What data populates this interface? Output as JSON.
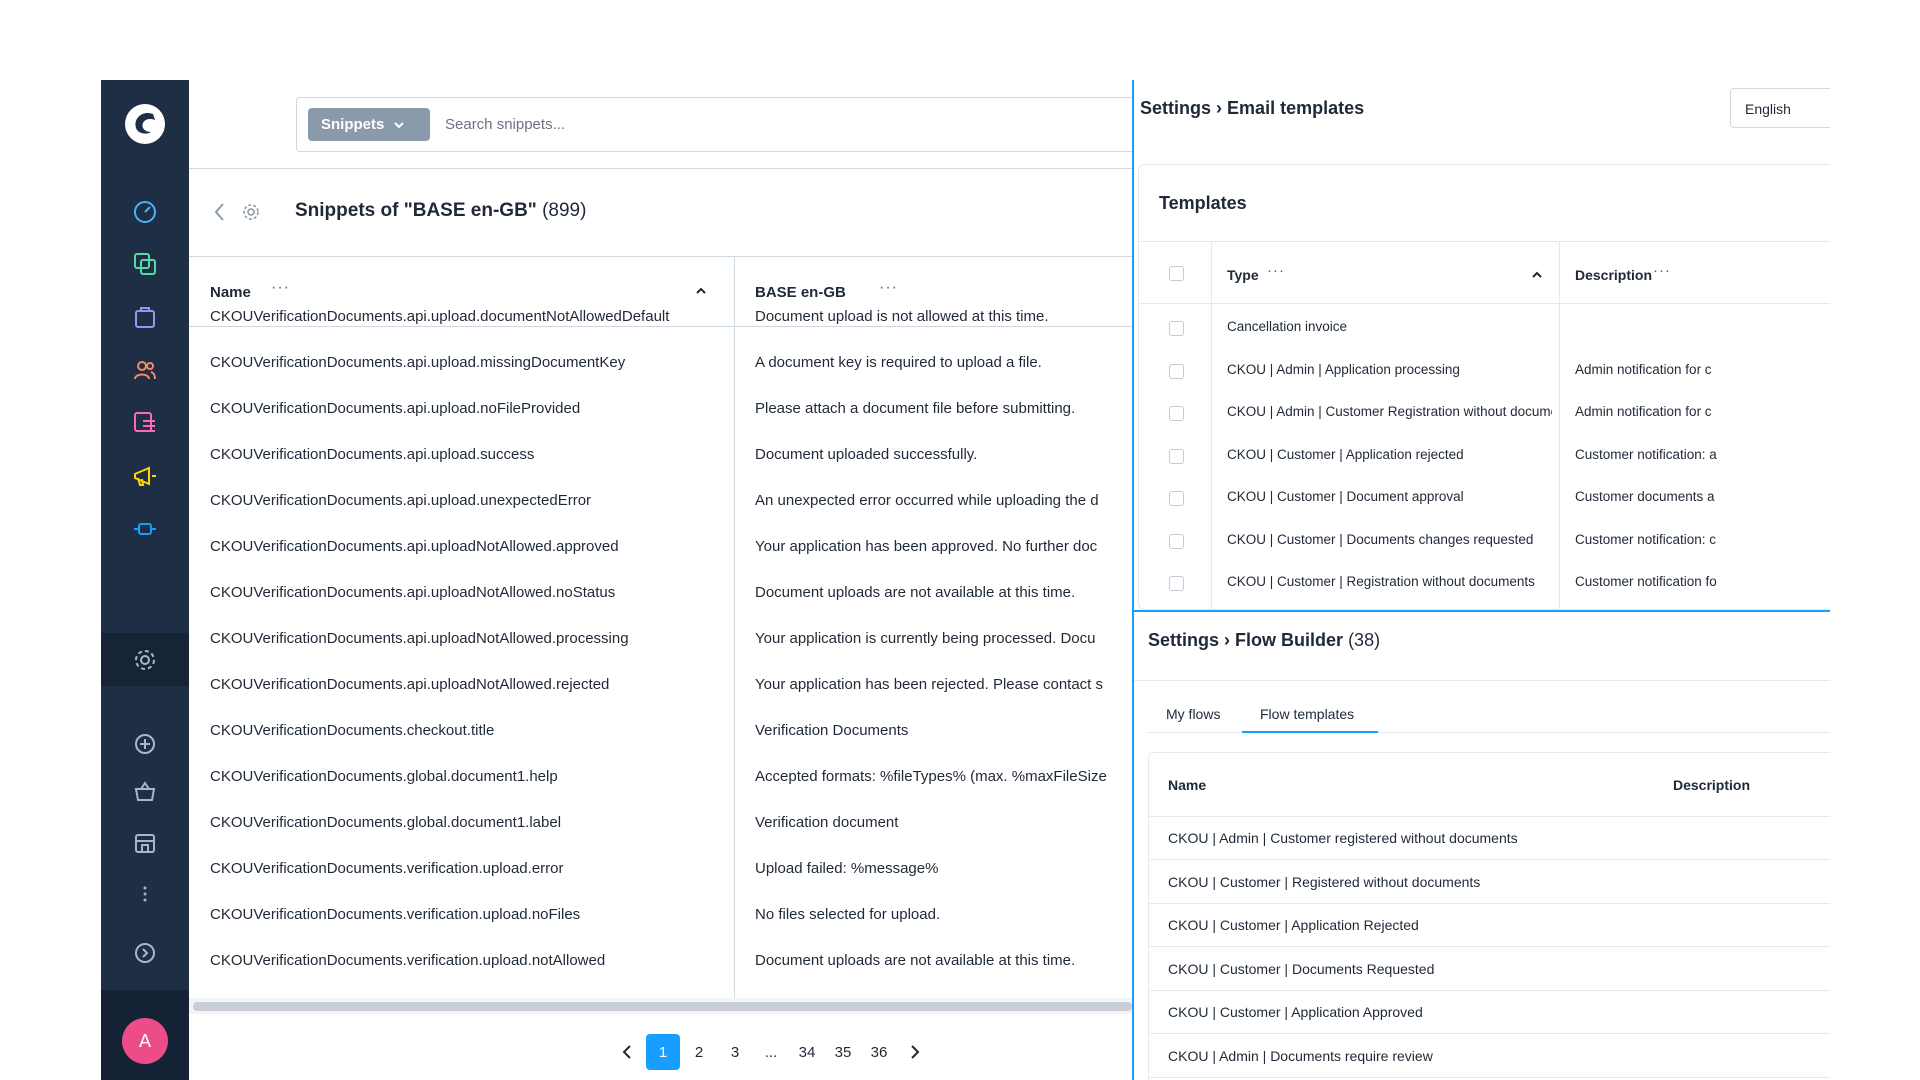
{
  "search": {
    "button_label": "Snippets",
    "placeholder": "Search snippets..."
  },
  "header": {
    "title": "Snippets of \"BASE en-GB\"",
    "count": "(899)"
  },
  "grid": {
    "columns": [
      "Name",
      "BASE en-GB"
    ],
    "dots": "···",
    "rows": [
      {
        "name": "CKOUVerificationDocuments.api.upload.documentNotAllowedDefault",
        "value": "Document upload is not allowed at this time."
      },
      {
        "name": "CKOUVerificationDocuments.api.upload.missingDocumentKey",
        "value": "A document key is required to upload a file."
      },
      {
        "name": "CKOUVerificationDocuments.api.upload.noFileProvided",
        "value": "Please attach a document file before submitting."
      },
      {
        "name": "CKOUVerificationDocuments.api.upload.success",
        "value": "Document uploaded successfully."
      },
      {
        "name": "CKOUVerificationDocuments.api.upload.unexpectedError",
        "value": "An unexpected error occurred while uploading the d"
      },
      {
        "name": "CKOUVerificationDocuments.api.uploadNotAllowed.approved",
        "value": "Your application has been approved. No further doc"
      },
      {
        "name": "CKOUVerificationDocuments.api.uploadNotAllowed.noStatus",
        "value": "Document uploads are not available at this time."
      },
      {
        "name": "CKOUVerificationDocuments.api.uploadNotAllowed.processing",
        "value": "Your application is currently being processed. Docu"
      },
      {
        "name": "CKOUVerificationDocuments.api.uploadNotAllowed.rejected",
        "value": "Your application has been rejected. Please contact s"
      },
      {
        "name": "CKOUVerificationDocuments.checkout.title",
        "value": "Verification Documents"
      },
      {
        "name": "CKOUVerificationDocuments.global.document1.help",
        "value": "Accepted formats: %fileTypes% (max. %maxFileSize"
      },
      {
        "name": "CKOUVerificationDocuments.global.document1.label",
        "value": "Verification document"
      },
      {
        "name": "CKOUVerificationDocuments.verification.upload.error",
        "value": "Upload failed: %message%"
      },
      {
        "name": "CKOUVerificationDocuments.verification.upload.noFiles",
        "value": "No files selected for upload."
      },
      {
        "name": "CKOUVerificationDocuments.verification.upload.notAllowed",
        "value": "Document uploads are not available at this time."
      }
    ]
  },
  "pagination": {
    "pages": [
      "1",
      "2",
      "3",
      "...",
      "34",
      "35",
      "36"
    ],
    "active": "1"
  },
  "user": {
    "avatar_letter": "A"
  },
  "email_templates": {
    "breadcrumb_parent": "Settings",
    "breadcrumb_current": "Email templates",
    "language": "English",
    "card_title": "Templates",
    "columns": [
      "Type",
      "Description"
    ],
    "rows": [
      {
        "type": "Cancellation invoice",
        "description": ""
      },
      {
        "type": "CKOU | Admin | Application processing",
        "description": "Admin notification for c"
      },
      {
        "type": "CKOU | Admin | Customer Registration without documents",
        "description": "Admin notification for c"
      },
      {
        "type": "CKOU | Customer | Application rejected",
        "description": "Customer notification: a"
      },
      {
        "type": "CKOU | Customer | Document approval",
        "description": "Customer documents a"
      },
      {
        "type": "CKOU | Customer | Documents changes requested",
        "description": "Customer notification: c"
      },
      {
        "type": "CKOU | Customer | Registration without documents",
        "description": "Customer notification fo"
      }
    ]
  },
  "flow_builder": {
    "breadcrumb_parent": "Settings",
    "breadcrumb_current": "Flow Builder",
    "count": "(38)",
    "tabs": [
      "My flows",
      "Flow templates"
    ],
    "columns": [
      "Name",
      "Description"
    ],
    "rows": [
      "CKOU | Admin | Customer registered without documents",
      "CKOU | Customer | Registered without documents",
      "CKOU | Customer | Application Rejected",
      "CKOU | Customer | Documents Requested",
      "CKOU | Customer | Application Approved",
      "CKOU | Admin | Documents require review"
    ]
  },
  "colors": {
    "sidebar_bg": "#1e2e44",
    "accent": "#189eff",
    "avatar": "#ec4d89"
  }
}
